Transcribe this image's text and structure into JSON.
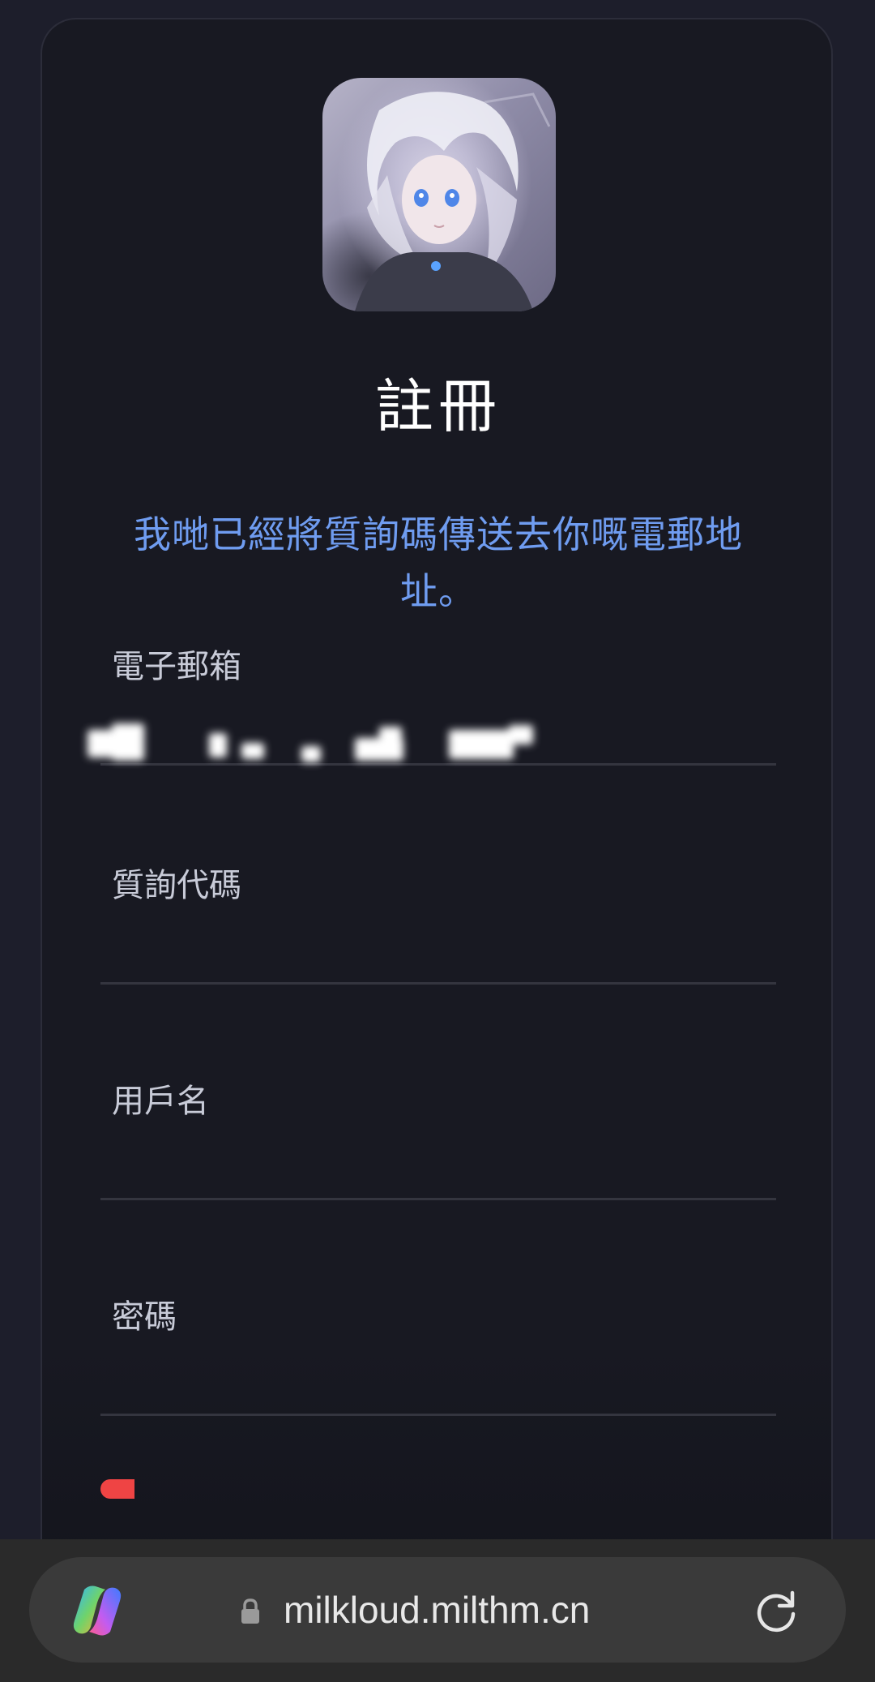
{
  "register": {
    "title": "註冊",
    "notice": "我哋已經將質詢碼傳送去你嘅電郵地址。"
  },
  "form": {
    "email_label": "電子郵箱",
    "code_label": "質詢代碼",
    "username_label": "用戶名",
    "password_label": "密碼"
  },
  "browser": {
    "url": "milkloud.milthm.cn"
  },
  "colors": {
    "accent": "#6f9cf0",
    "error": "#ef4444",
    "background": "#181922"
  }
}
